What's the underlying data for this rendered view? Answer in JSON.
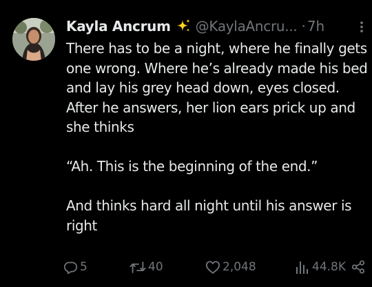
{
  "tweet": {
    "author": {
      "display_name": "Kayla Ancrum",
      "badge_icon": "sparkles-icon",
      "handle": "@KaylaAncru...",
      "separator": "·",
      "time": "7h"
    },
    "text": {
      "paragraph_1": "There has to be a night, where he finally gets one wrong. Where he’s already made his bed and lay his grey head down, eyes closed. After he answers, her lion ears prick up and she thinks",
      "paragraph_2": "“Ah. This is the beginning of the end.”",
      "paragraph_3": "And thinks hard all night until his answer is right"
    },
    "actions": {
      "replies": "5",
      "reposts": "40",
      "likes": "2,048",
      "views": "44.8K"
    },
    "colors": {
      "background": "#000000",
      "primary_text": "#e7e9ea",
      "secondary_text": "#71767b",
      "sparkle": "#ffd21f"
    }
  }
}
